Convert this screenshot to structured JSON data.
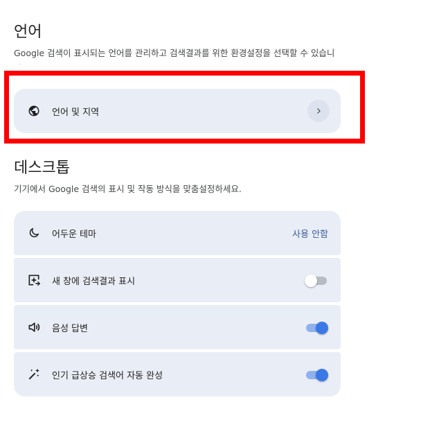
{
  "language_section": {
    "title": "언어",
    "description": "Google 검색이 표시되는 언어를 관리하고 검색결과를 위한 환경설정을 선택할 수 있습니다.",
    "items": [
      {
        "label": "언어 및 지역",
        "icon": "globe-icon",
        "control": "chevron-right-icon"
      }
    ]
  },
  "desktop_section": {
    "title": "데스크톱",
    "description": "기기에서 Google 검색의 표시 및 작동 방식을 맞춤설정하세요.",
    "items": [
      {
        "label": "어두운 테마",
        "icon": "moon-icon",
        "value": "사용 안함"
      },
      {
        "label": "새 창에 검색결과 표시",
        "icon": "new-window-icon",
        "toggle": false
      },
      {
        "label": "음성 답변",
        "icon": "speaker-icon",
        "toggle": true
      },
      {
        "label": "인기 급상승 검색어 자동 완성",
        "icon": "magic-wand-icon",
        "toggle": true
      }
    ]
  },
  "colors": {
    "card_background": "#e9eef6",
    "accent": "#3b78e7",
    "highlight_box": "#ff0000"
  }
}
